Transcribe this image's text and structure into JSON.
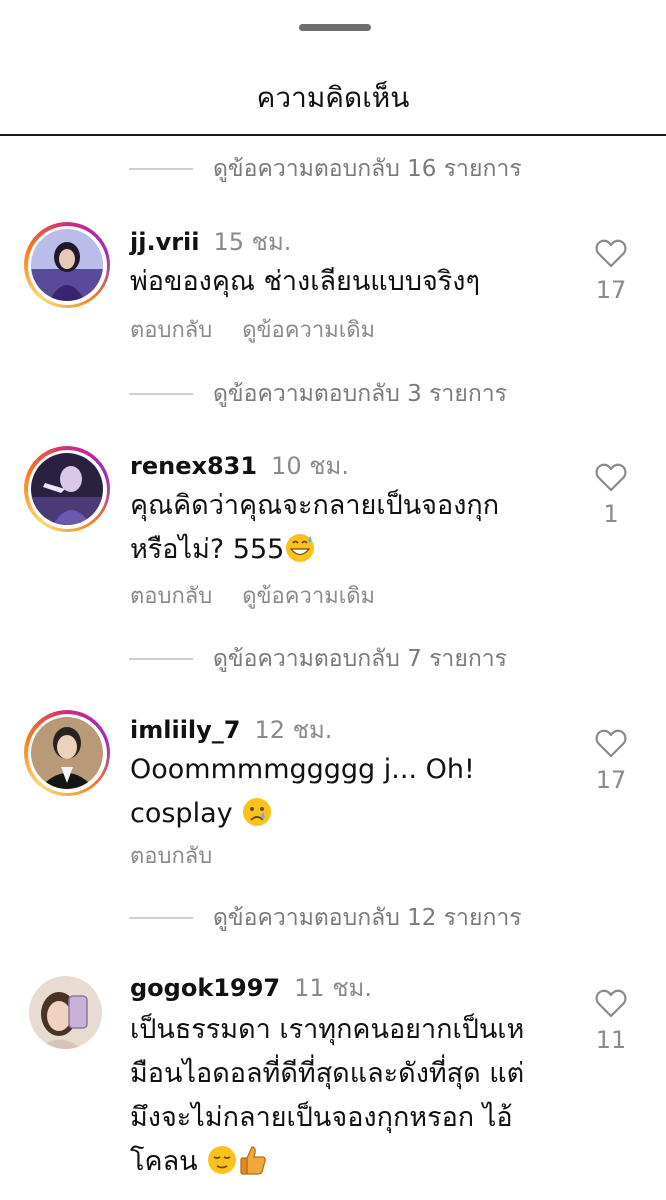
{
  "header": {
    "title": "ความคิดเห็น"
  },
  "view_replies": [
    "ดูข้อความตอบกลับ 16 รายการ",
    "ดูข้อความตอบกลับ 3 รายการ",
    "ดูข้อความตอบกลับ 7 รายการ",
    "ดูข้อความตอบกลับ 12 รายการ"
  ],
  "comments": [
    {
      "username": "jj.vrii",
      "time": "15 ชม.",
      "lines": [
        "พ่อของคุณ ช่างเลียนแบบจริงๆ"
      ],
      "likes": "17",
      "actions": [
        "ตอบกลับ",
        "ดูข้อความเดิม"
      ],
      "has_story_ring": true
    },
    {
      "username": "renex831",
      "time": "10 ชม.",
      "lines": [
        "คุณคิดว่าคุณจะกลายเป็นจองกุก",
        "หรือไม่? 555"
      ],
      "likes": "1",
      "actions": [
        "ตอบกลับ",
        "ดูข้อความเดิม"
      ],
      "emoji": "grinning-sweat-emoji",
      "has_story_ring": true
    },
    {
      "username": "imliily_7",
      "time": "12 ชม.",
      "lines": [
        "Ooommmmggggg j... Oh!",
        "cosplay"
      ],
      "likes": "17",
      "actions": [
        "ตอบกลับ"
      ],
      "emoji": "crying-face-emoji",
      "has_story_ring": true
    },
    {
      "username": "gogok1997",
      "time": "11 ชม.",
      "lines": [
        "เป็นธรรมดา เราทุกคนอยากเป็นเห",
        "มือนไอดอลที่ดีที่สุดและดังที่สุด แต่",
        "มึงจะไม่กลายเป็นจองกุกหรอก ไอ้",
        "โคลน"
      ],
      "likes": "11",
      "emoji": [
        "relieved-face-emoji",
        "thumbs-up-emoji"
      ],
      "has_story_ring": false
    }
  ],
  "icons": {
    "like": "heart-outline-icon"
  },
  "colors": {
    "story_ring": [
      "#d62976",
      "#962fbf",
      "#fa7e1e",
      "#feda75"
    ],
    "secondary_text": "#8a8a8a"
  }
}
